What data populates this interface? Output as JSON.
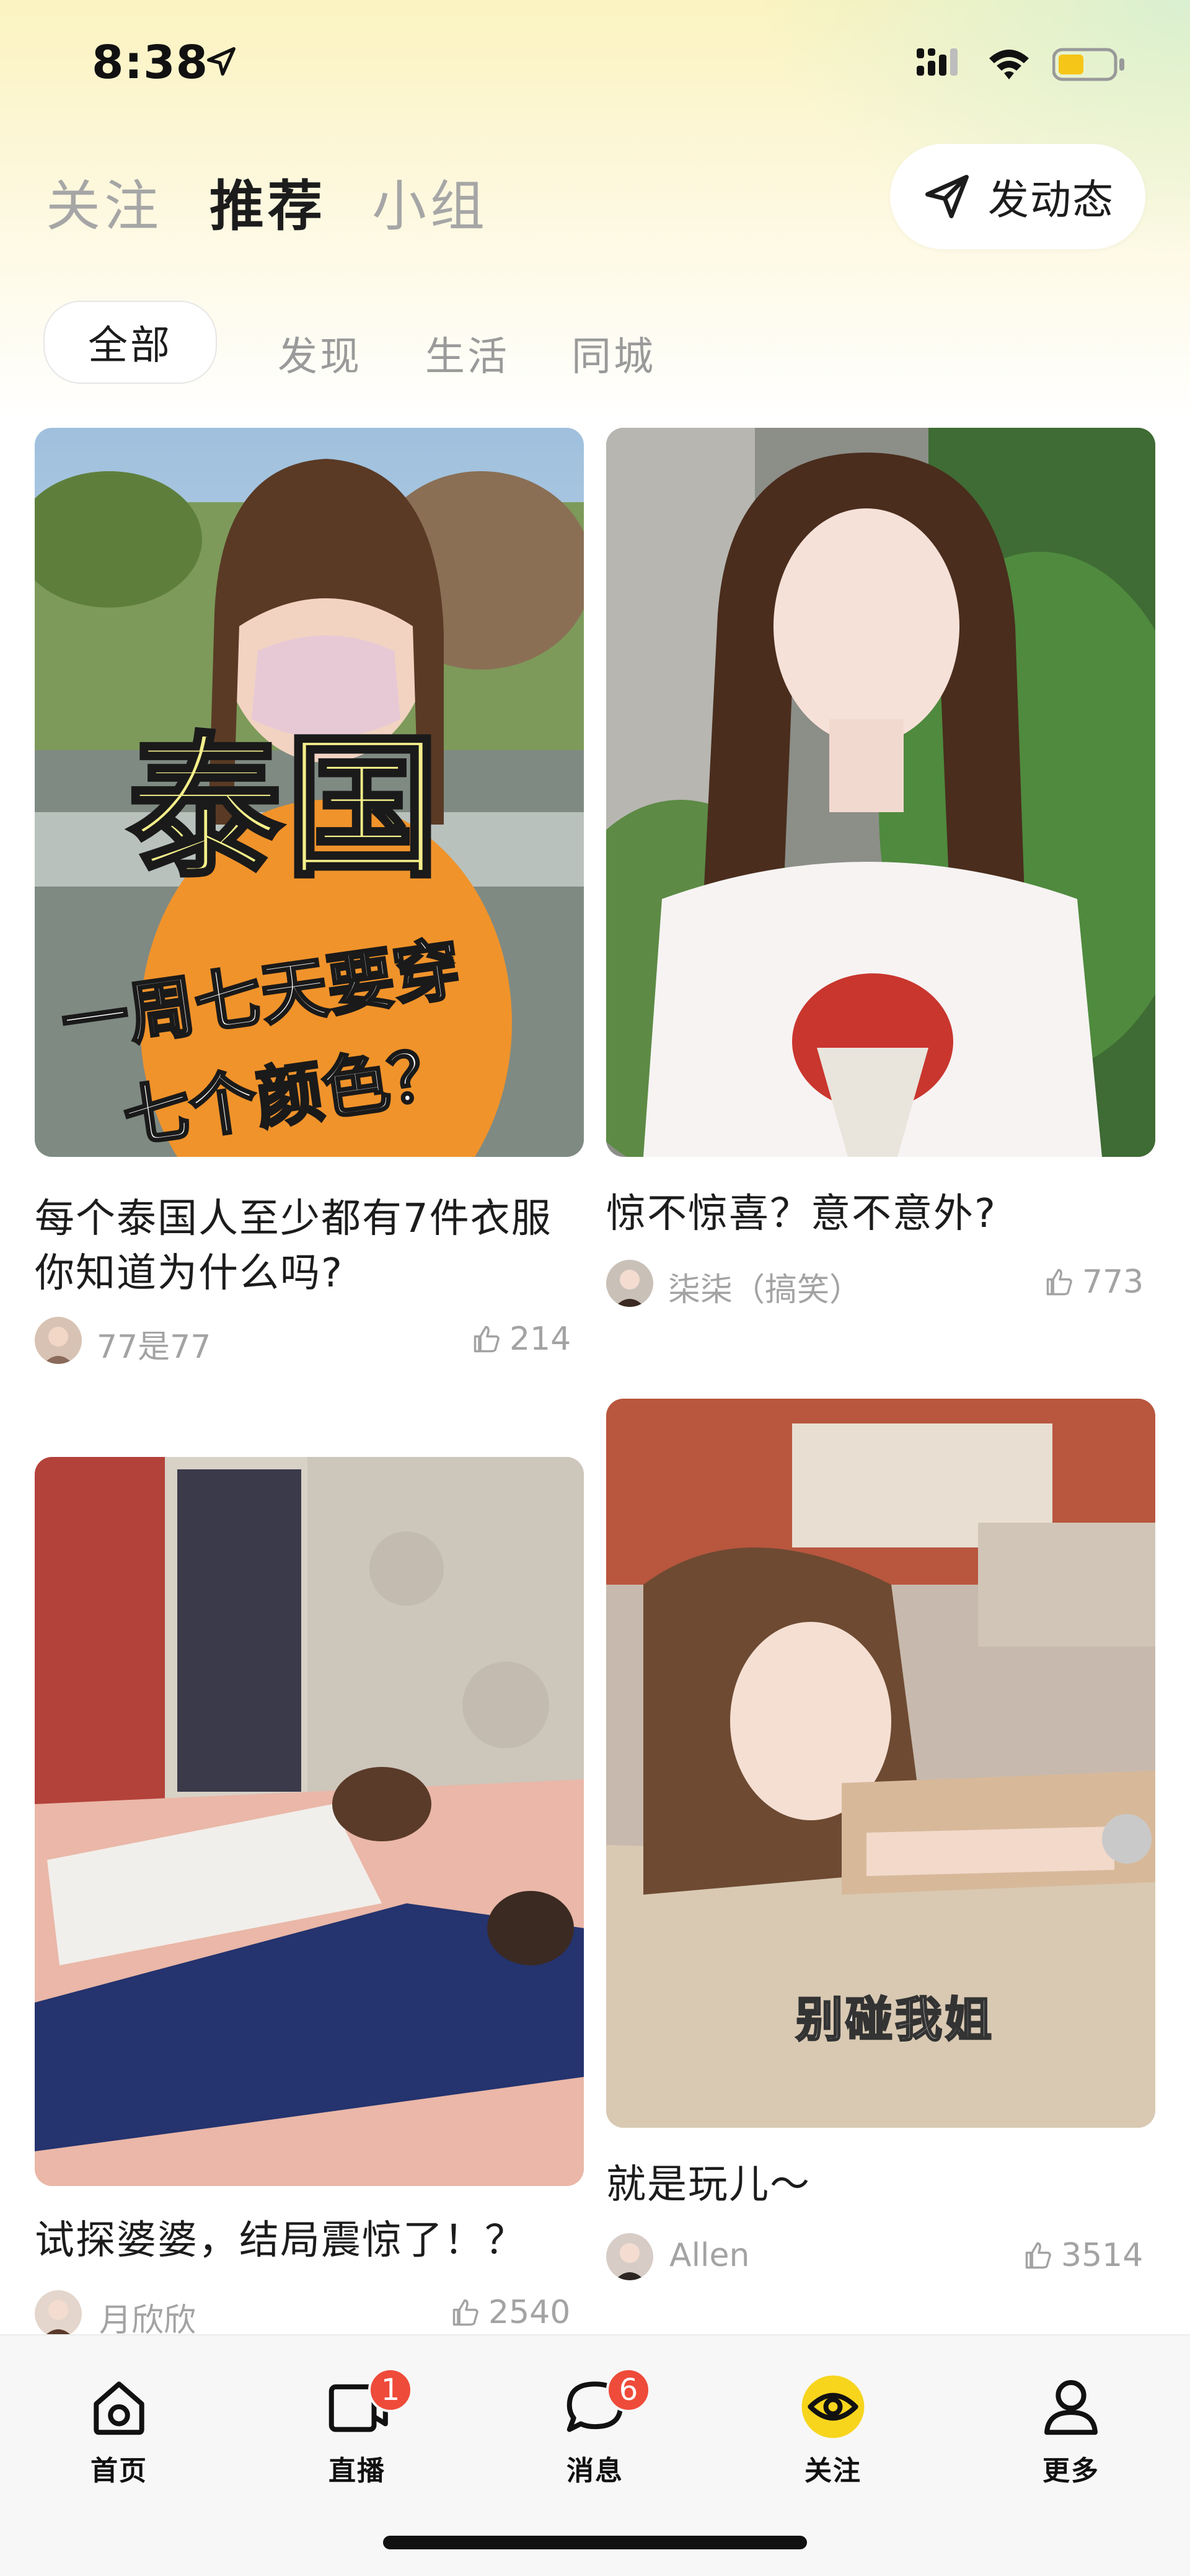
{
  "status_bar": {
    "time": "8:38"
  },
  "top_tabs": [
    {
      "label": "关注",
      "active": false
    },
    {
      "label": "推荐",
      "active": true
    },
    {
      "label": "小组",
      "active": false
    }
  ],
  "post_button": {
    "label": "发动态"
  },
  "filters": [
    {
      "label": "全部",
      "active": true
    },
    {
      "label": "发现",
      "active": false
    },
    {
      "label": "生活",
      "active": false
    },
    {
      "label": "同城",
      "active": false
    }
  ],
  "feed": {
    "cards": [
      {
        "title": "每个泰国人至少都有7件衣服 你知道为什么吗?",
        "author": "77是77",
        "likes": "214",
        "image_text_big": "泰国",
        "image_text_line1": "一周七天要穿",
        "image_text_line2": "七个颜色？"
      },
      {
        "title": "惊不惊喜？意不意外?",
        "author": "柒柒（搞笑）",
        "likes": "773"
      },
      {
        "title": "试探婆婆，结局震惊了！？",
        "author": "月欣欣",
        "likes": "2540"
      },
      {
        "title": "就是玩儿～",
        "author": "Allen",
        "likes": "3514",
        "image_caption": "别碰我姐"
      }
    ]
  },
  "bottom_nav": [
    {
      "label": "首页",
      "icon": "home-icon"
    },
    {
      "label": "直播",
      "icon": "live-icon",
      "badge": "1"
    },
    {
      "label": "消息",
      "icon": "message-icon",
      "badge": "6"
    },
    {
      "label": "关注",
      "icon": "follow-eye-icon",
      "active": true
    },
    {
      "label": "更多",
      "icon": "profile-icon"
    }
  ],
  "colors": {
    "accent_yellow": "#f7d51d",
    "badge_red": "#ef4b3a",
    "header_gradient": "#fbf3c0"
  }
}
